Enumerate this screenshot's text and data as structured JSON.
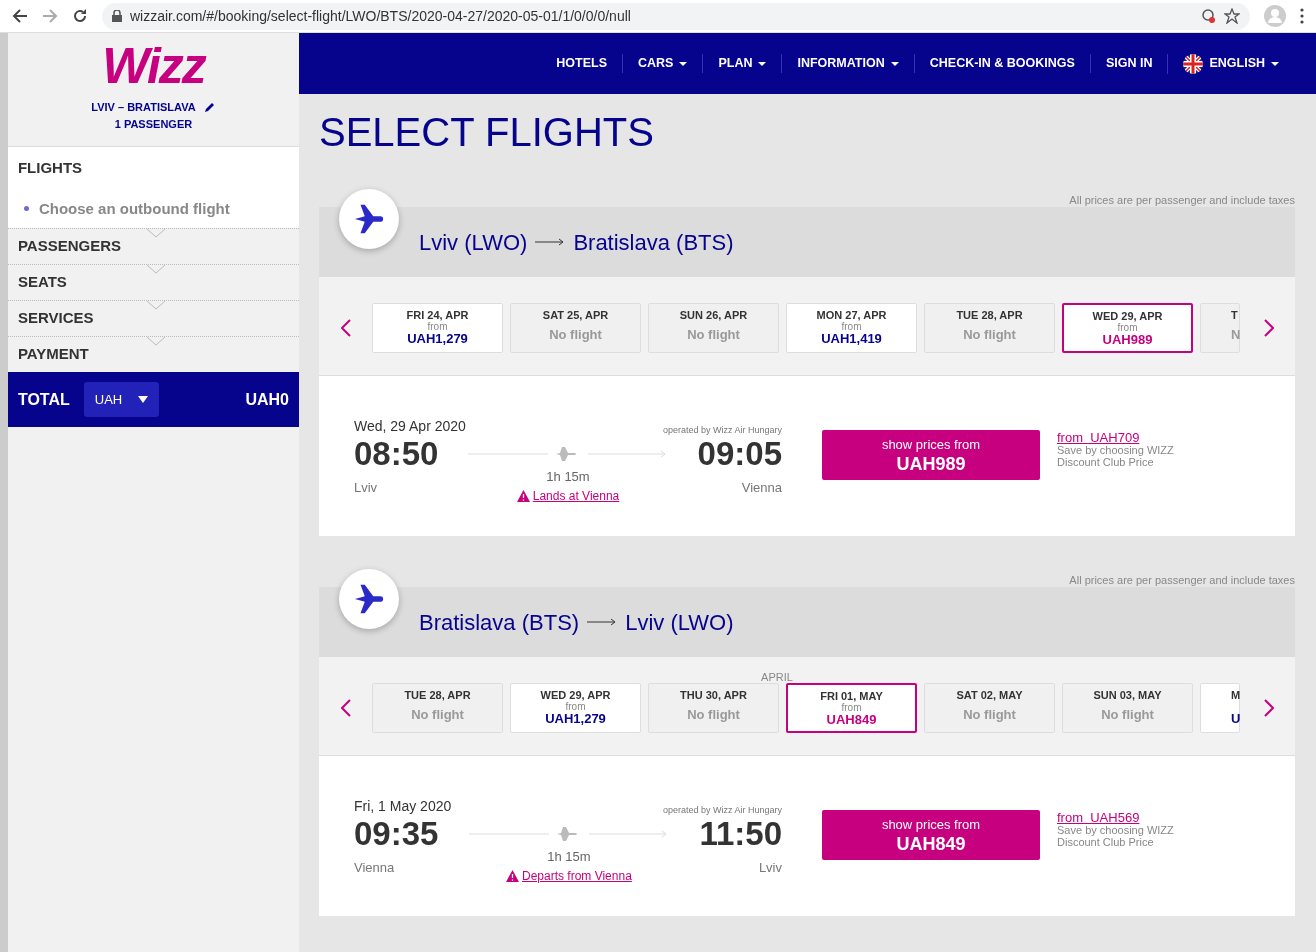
{
  "browser": {
    "url": "wizzair.com/#/booking/select-flight/LWO/BTS/2020-04-27/2020-05-01/1/0/0/0/null"
  },
  "sidebar": {
    "logo": "Wizz",
    "route": "LVIV – BRATISLAVA",
    "passengers": "1 PASSENGER",
    "steps": [
      {
        "label": "FLIGHTS",
        "current": true,
        "substep": "Choose an outbound flight"
      },
      {
        "label": "PASSENGERS",
        "current": false
      },
      {
        "label": "SEATS",
        "current": false
      },
      {
        "label": "SERVICES",
        "current": false
      },
      {
        "label": "PAYMENT",
        "current": false
      }
    ],
    "total": {
      "label": "TOTAL",
      "currency": "UAH",
      "amount": "UAH0"
    }
  },
  "nav": {
    "items": [
      {
        "label": "HOTELS",
        "dropdown": false
      },
      {
        "label": "CARS",
        "dropdown": true
      },
      {
        "label": "PLAN",
        "dropdown": true
      },
      {
        "label": "INFORMATION",
        "dropdown": true
      },
      {
        "label": "CHECK-IN & BOOKINGS",
        "dropdown": false
      },
      {
        "label": "SIGN IN",
        "dropdown": false
      }
    ],
    "language": {
      "label": "ENGLISH",
      "dropdown": true
    }
  },
  "title": "SELECT FLIGHTS",
  "legs": [
    {
      "note": "All prices are per passenger and include taxes",
      "origin": "Lviv (LWO)",
      "destination": "Bratislava (BTS)",
      "dates": [
        {
          "kind": "price",
          "day": "FRI 24, APR",
          "from": "from",
          "value": "UAH1,279",
          "selected": false
        },
        {
          "kind": "none",
          "day": "SAT 25, APR",
          "value": "No flight",
          "selected": false
        },
        {
          "kind": "none",
          "day": "SUN 26, APR",
          "value": "No flight",
          "selected": false
        },
        {
          "kind": "price",
          "day": "MON 27, APR",
          "from": "from",
          "value": "UAH1,419",
          "selected": false
        },
        {
          "kind": "none",
          "day": "TUE 28, APR",
          "value": "No flight",
          "selected": false
        },
        {
          "kind": "price",
          "day": "WED 29, APR",
          "from": "from",
          "value": "UAH989",
          "selected": true
        },
        {
          "kind": "cut-none",
          "day": "T",
          "value": "N",
          "selected": false
        }
      ],
      "flight": {
        "date": "Wed, 29 Apr 2020",
        "operator": "operated by Wizz Air Hungary",
        "dep_time": "08:50",
        "dep_city": "Lviv",
        "arr_time": "09:05",
        "arr_city": "Vienna",
        "duration": "1h 15m",
        "warning": "Lands at Vienna",
        "button_label": "show prices from",
        "button_price": "UAH989",
        "club_from": "from",
        "club_price": "UAH709",
        "club_note": "Save by choosing WIZZ Discount Club Price"
      }
    },
    {
      "note": "All prices are per passenger and include taxes",
      "origin": "Bratislava (BTS)",
      "destination": "Lviv (LWO)",
      "month": "APRIL",
      "dates": [
        {
          "kind": "none",
          "day": "TUE 28, APR",
          "value": "No flight",
          "selected": false
        },
        {
          "kind": "price",
          "day": "WED 29, APR",
          "from": "from",
          "value": "UAH1,279",
          "selected": false
        },
        {
          "kind": "none",
          "day": "THU 30, APR",
          "value": "No flight",
          "selected": false
        },
        {
          "kind": "price",
          "day": "FRI 01, MAY",
          "from": "from",
          "value": "UAH849",
          "selected": true
        },
        {
          "kind": "none",
          "day": "SAT 02, MAY",
          "value": "No flight",
          "selected": false
        },
        {
          "kind": "none",
          "day": "SUN 03, MAY",
          "value": "No flight",
          "selected": false
        },
        {
          "kind": "cut-price",
          "day": "M",
          "value": "U",
          "selected": false
        }
      ],
      "flight": {
        "date": "Fri, 1 May 2020",
        "operator": "operated by Wizz Air Hungary",
        "dep_time": "09:35",
        "dep_city": "Vienna",
        "arr_time": "11:50",
        "arr_city": "Lviv",
        "duration": "1h 15m",
        "warning": "Departs from Vienna",
        "button_label": "show prices from",
        "button_price": "UAH849",
        "club_from": "from",
        "club_price": "UAH569",
        "club_note": "Save by choosing WIZZ Discount Club Price"
      }
    }
  ]
}
